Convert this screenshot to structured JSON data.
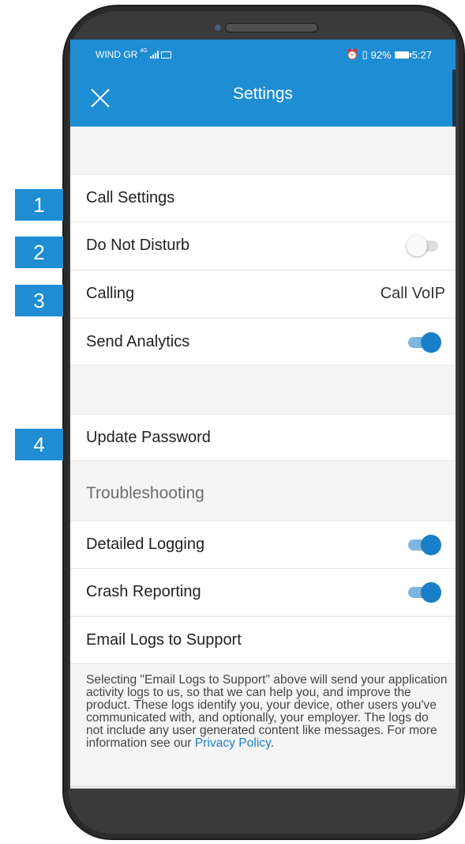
{
  "status_bar": {
    "carrier": "WIND GR",
    "network": "4G",
    "battery": "92%",
    "time": "5:27"
  },
  "toolbar": {
    "title": "Settings",
    "close_icon": "close-icon"
  },
  "rows": {
    "call_settings": {
      "label": "Call Settings"
    },
    "do_not_disturb": {
      "label": "Do Not Disturb",
      "enabled": false
    },
    "calling": {
      "label": "Calling",
      "value": "Call VoIP"
    },
    "send_analytics": {
      "label": "Send Analytics",
      "enabled": true
    },
    "update_password": {
      "label": "Update Password"
    },
    "detailed_logging": {
      "label": "Detailed Logging",
      "enabled": true
    },
    "crash_reporting": {
      "label": "Crash Reporting",
      "enabled": true
    },
    "email_logs": {
      "label": "Email Logs to Support"
    }
  },
  "troubleshooting_header": "Troubleshooting",
  "footer": {
    "text": "Selecting \"Email Logs to Support\" above will send your application activity logs to us, so that we can help you, and improve the product. These logs identify you, your device, other users you've communicated with, and optionally, your employer. The logs do not include any user generated content like messages. For more information see our",
    "link_text": "Privacy Policy",
    "end": "."
  },
  "callouts": [
    "1",
    "2",
    "3",
    "4"
  ],
  "colors": {
    "accent": "#1e8dd4",
    "toggle_on": "#1a7fc8",
    "background": "#f5f5f5"
  },
  "nav_icons": [
    "back-icon",
    "home-icon",
    "recents-icon"
  ]
}
